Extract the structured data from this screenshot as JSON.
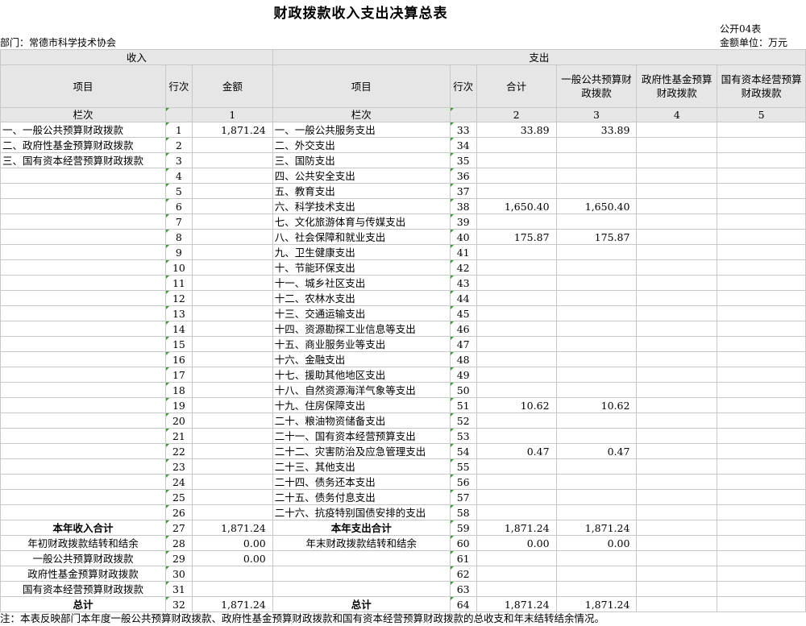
{
  "title": "财政拨款收入支出决算总表",
  "form_code": "公开04表",
  "department": "部门：常德市科学技术协会",
  "unit": "金额单位：万元",
  "headers": {
    "income": "收入",
    "expense": "支出",
    "item": "项目",
    "row_no": "行次",
    "amount": "金额",
    "total": "合计",
    "general_budget": "一般公共预算财政拨款",
    "gov_fund": "政府性基金预算财政拨款",
    "state_capital": "国有资本经营预算财政拨款",
    "column_label": "栏次",
    "col1": "1",
    "col2": "2",
    "col3": "3",
    "col4": "4",
    "col5": "5"
  },
  "rows": [
    {
      "in_item": "一、一般公共预算财政拨款",
      "in_no": "1",
      "in_amt": "1,871.24",
      "out_item": "一、一般公共服务支出",
      "out_no": "33",
      "total": "33.89",
      "gen": "33.89",
      "fund": "",
      "cap": ""
    },
    {
      "in_item": "二、政府性基金预算财政拨款",
      "in_no": "2",
      "in_amt": "",
      "out_item": "二、外交支出",
      "out_no": "34",
      "total": "",
      "gen": "",
      "fund": "",
      "cap": ""
    },
    {
      "in_item": "三、国有资本经营预算财政拨款",
      "in_no": "3",
      "in_amt": "",
      "out_item": "三、国防支出",
      "out_no": "35",
      "total": "",
      "gen": "",
      "fund": "",
      "cap": ""
    },
    {
      "in_item": "",
      "in_no": "4",
      "in_amt": "",
      "out_item": "四、公共安全支出",
      "out_no": "36",
      "total": "",
      "gen": "",
      "fund": "",
      "cap": ""
    },
    {
      "in_item": "",
      "in_no": "5",
      "in_amt": "",
      "out_item": "五、教育支出",
      "out_no": "37",
      "total": "",
      "gen": "",
      "fund": "",
      "cap": ""
    },
    {
      "in_item": "",
      "in_no": "6",
      "in_amt": "",
      "out_item": "六、科学技术支出",
      "out_no": "38",
      "total": "1,650.40",
      "gen": "1,650.40",
      "fund": "",
      "cap": ""
    },
    {
      "in_item": "",
      "in_no": "7",
      "in_amt": "",
      "out_item": "七、文化旅游体育与传媒支出",
      "out_no": "39",
      "total": "",
      "gen": "",
      "fund": "",
      "cap": ""
    },
    {
      "in_item": "",
      "in_no": "8",
      "in_amt": "",
      "out_item": "八、社会保障和就业支出",
      "out_no": "40",
      "total": "175.87",
      "gen": "175.87",
      "fund": "",
      "cap": ""
    },
    {
      "in_item": "",
      "in_no": "9",
      "in_amt": "",
      "out_item": "九、卫生健康支出",
      "out_no": "41",
      "total": "",
      "gen": "",
      "fund": "",
      "cap": ""
    },
    {
      "in_item": "",
      "in_no": "10",
      "in_amt": "",
      "out_item": "十、节能环保支出",
      "out_no": "42",
      "total": "",
      "gen": "",
      "fund": "",
      "cap": ""
    },
    {
      "in_item": "",
      "in_no": "11",
      "in_amt": "",
      "out_item": "十一、城乡社区支出",
      "out_no": "43",
      "total": "",
      "gen": "",
      "fund": "",
      "cap": ""
    },
    {
      "in_item": "",
      "in_no": "12",
      "in_amt": "",
      "out_item": "十二、农林水支出",
      "out_no": "44",
      "total": "",
      "gen": "",
      "fund": "",
      "cap": ""
    },
    {
      "in_item": "",
      "in_no": "13",
      "in_amt": "",
      "out_item": "十三、交通运输支出",
      "out_no": "45",
      "total": "",
      "gen": "",
      "fund": "",
      "cap": ""
    },
    {
      "in_item": "",
      "in_no": "14",
      "in_amt": "",
      "out_item": "十四、资源勘探工业信息等支出",
      "out_no": "46",
      "total": "",
      "gen": "",
      "fund": "",
      "cap": ""
    },
    {
      "in_item": "",
      "in_no": "15",
      "in_amt": "",
      "out_item": "十五、商业服务业等支出",
      "out_no": "47",
      "total": "",
      "gen": "",
      "fund": "",
      "cap": ""
    },
    {
      "in_item": "",
      "in_no": "16",
      "in_amt": "",
      "out_item": "十六、金融支出",
      "out_no": "48",
      "total": "",
      "gen": "",
      "fund": "",
      "cap": ""
    },
    {
      "in_item": "",
      "in_no": "17",
      "in_amt": "",
      "out_item": "十七、援助其他地区支出",
      "out_no": "49",
      "total": "",
      "gen": "",
      "fund": "",
      "cap": ""
    },
    {
      "in_item": "",
      "in_no": "18",
      "in_amt": "",
      "out_item": "十八、自然资源海洋气象等支出",
      "out_no": "50",
      "total": "",
      "gen": "",
      "fund": "",
      "cap": ""
    },
    {
      "in_item": "",
      "in_no": "19",
      "in_amt": "",
      "out_item": "十九、住房保障支出",
      "out_no": "51",
      "total": "10.62",
      "gen": "10.62",
      "fund": "",
      "cap": ""
    },
    {
      "in_item": "",
      "in_no": "20",
      "in_amt": "",
      "out_item": "二十、粮油物资储备支出",
      "out_no": "52",
      "total": "",
      "gen": "",
      "fund": "",
      "cap": ""
    },
    {
      "in_item": "",
      "in_no": "21",
      "in_amt": "",
      "out_item": "二十一、国有资本经营预算支出",
      "out_no": "53",
      "total": "",
      "gen": "",
      "fund": "",
      "cap": ""
    },
    {
      "in_item": "",
      "in_no": "22",
      "in_amt": "",
      "out_item": "二十二、灾害防治及应急管理支出",
      "out_no": "54",
      "total": "0.47",
      "gen": "0.47",
      "fund": "",
      "cap": ""
    },
    {
      "in_item": "",
      "in_no": "23",
      "in_amt": "",
      "out_item": "二十三、其他支出",
      "out_no": "55",
      "total": "",
      "gen": "",
      "fund": "",
      "cap": ""
    },
    {
      "in_item": "",
      "in_no": "24",
      "in_amt": "",
      "out_item": "二十四、债务还本支出",
      "out_no": "56",
      "total": "",
      "gen": "",
      "fund": "",
      "cap": ""
    },
    {
      "in_item": "",
      "in_no": "25",
      "in_amt": "",
      "out_item": "二十五、债务付息支出",
      "out_no": "57",
      "total": "",
      "gen": "",
      "fund": "",
      "cap": ""
    },
    {
      "in_item": "",
      "in_no": "26",
      "in_amt": "",
      "out_item": "二十六、抗疫特别国债安排的支出",
      "out_no": "58",
      "total": "",
      "gen": "",
      "fund": "",
      "cap": ""
    }
  ],
  "summary": [
    {
      "in_item": "本年收入合计",
      "in_no": "27",
      "in_amt": "1,871.24",
      "out_item": "本年支出合计",
      "out_no": "59",
      "total": "1,871.24",
      "gen": "1,871.24",
      "fund": "",
      "cap": "",
      "bold": true
    },
    {
      "in_item": "年初财政拨款结转和结余",
      "in_no": "28",
      "in_amt": "0.00",
      "out_item": "年末财政拨款结转和结余",
      "out_no": "60",
      "total": "0.00",
      "gen": "0.00",
      "fund": "",
      "cap": "",
      "bold": false
    },
    {
      "in_item": "一般公共预算财政拨款",
      "in_no": "29",
      "in_amt": "0.00",
      "out_item": "",
      "out_no": "61",
      "total": "",
      "gen": "",
      "fund": "",
      "cap": "",
      "bold": false
    },
    {
      "in_item": "政府性基金预算财政拨款",
      "in_no": "30",
      "in_amt": "",
      "out_item": "",
      "out_no": "62",
      "total": "",
      "gen": "",
      "fund": "",
      "cap": "",
      "bold": false
    },
    {
      "in_item": "国有资本经营预算财政拨款",
      "in_no": "31",
      "in_amt": "",
      "out_item": "",
      "out_no": "63",
      "total": "",
      "gen": "",
      "fund": "",
      "cap": "",
      "bold": false
    },
    {
      "in_item": "总计",
      "in_no": "32",
      "in_amt": "1,871.24",
      "out_item": "总计",
      "out_no": "64",
      "total": "1,871.24",
      "gen": "1,871.24",
      "fund": "",
      "cap": "",
      "bold": true
    }
  ],
  "note": "注：本表反映部门本年度一般公共预算财政拨款、政府性基金预算财政拨款和国有资本经营预算财政拨款的总收支和年末结转结余情况。"
}
